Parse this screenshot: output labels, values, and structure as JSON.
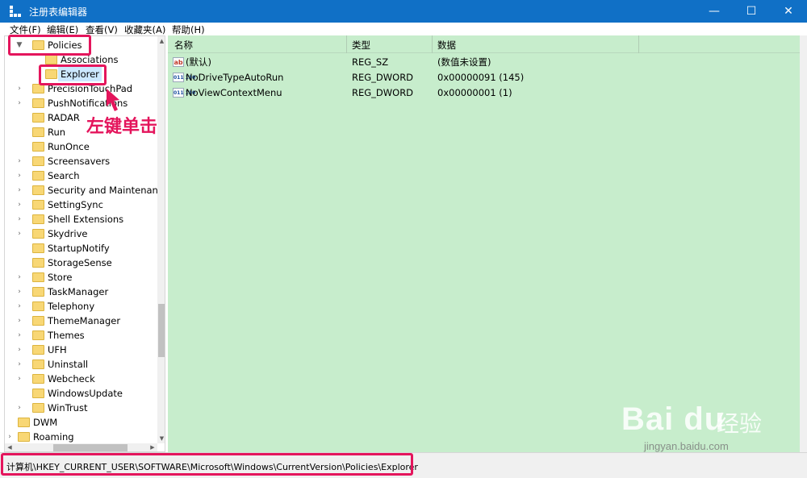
{
  "window": {
    "title": "注册表编辑器",
    "minimize": "—",
    "maximize": "☐",
    "close": "✕"
  },
  "menu": [
    "文件(F)",
    "编辑(E)",
    "查看(V)",
    "收藏夹(A)",
    "帮助(H)"
  ],
  "tree": {
    "items": [
      {
        "label": "Policies",
        "expanded": true
      },
      {
        "label": "Associations"
      },
      {
        "label": "Explorer",
        "selected": true
      },
      {
        "label": "PrecisionTouchPad"
      },
      {
        "label": "PushNotifications"
      },
      {
        "label": "RADAR"
      },
      {
        "label": "Run"
      },
      {
        "label": "RunOnce"
      },
      {
        "label": "Screensavers"
      },
      {
        "label": "Search"
      },
      {
        "label": "Security and Maintenance"
      },
      {
        "label": "SettingSync"
      },
      {
        "label": "Shell Extensions"
      },
      {
        "label": "Skydrive"
      },
      {
        "label": "StartupNotify"
      },
      {
        "label": "StorageSense"
      },
      {
        "label": "Store"
      },
      {
        "label": "TaskManager"
      },
      {
        "label": "Telephony"
      },
      {
        "label": "ThemeManager"
      },
      {
        "label": "Themes"
      },
      {
        "label": "UFH"
      },
      {
        "label": "Uninstall"
      },
      {
        "label": "Webcheck"
      },
      {
        "label": "WindowsUpdate"
      },
      {
        "label": "WinTrust"
      },
      {
        "label": "DWM"
      },
      {
        "label": "Roaming"
      }
    ]
  },
  "values": {
    "columns": {
      "name": "名称",
      "type": "类型",
      "data": "数据"
    },
    "rows": [
      {
        "icon": "ab",
        "name": "(默认)",
        "type": "REG_SZ",
        "data": "(数值未设置)"
      },
      {
        "icon": "011 110",
        "name": "NoDriveTypeAutoRun",
        "type": "REG_DWORD",
        "data": "0x00000091 (145)"
      },
      {
        "icon": "011 110",
        "name": "NoViewContextMenu",
        "type": "REG_DWORD",
        "data": "0x00000001 (1)"
      }
    ]
  },
  "status": {
    "path": "计算机\\HKEY_CURRENT_USER\\SOFTWARE\\Microsoft\\Windows\\CurrentVersion\\Policies\\Explorer"
  },
  "annotation": {
    "text": "左键单击",
    "color": "#e4155c"
  },
  "watermark": {
    "brand": "Bai du",
    "cn": "经验",
    "url": "jingyan.baidu.com"
  },
  "colors": {
    "titlebar": "#1070c6",
    "values_bg": "#c7edcc",
    "highlight": "#e4155c",
    "selection": "#cce8ff"
  }
}
